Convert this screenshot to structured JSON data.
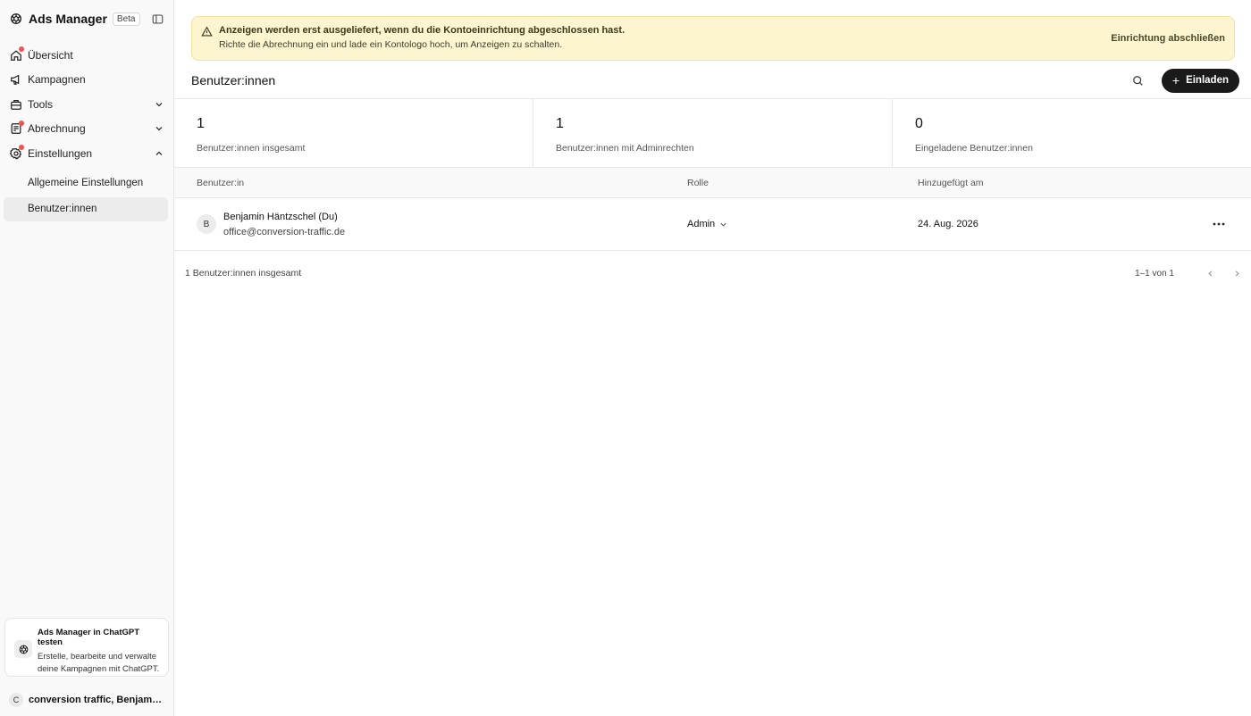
{
  "sidebar": {
    "app_title": "Ads Manager",
    "beta_badge": "Beta",
    "nav": [
      {
        "label": "Übersicht",
        "icon": "home-icon",
        "has_dot": true
      },
      {
        "label": "Kampagnen",
        "icon": "megaphone-icon",
        "has_dot": false
      },
      {
        "label": "Tools",
        "icon": "toolbox-icon",
        "has_dot": false,
        "expandable": true
      },
      {
        "label": "Abrechnung",
        "icon": "billing-icon",
        "has_dot": true,
        "expandable": true
      },
      {
        "label": "Einstellungen",
        "icon": "gear-icon",
        "has_dot": true,
        "expanded": true
      }
    ],
    "sub_items": [
      {
        "label": "Allgemeine Einstellungen",
        "active": false
      },
      {
        "label": "Benutzer:innen",
        "active": true
      }
    ],
    "promo": {
      "title": "Ads Manager in ChatGPT testen",
      "text": "Erstelle, bearbeite und verwalte deine Kampagnen mit ChatGPT."
    },
    "account": {
      "initial": "C",
      "name": "conversion traffic, Benjamin Häntzschel"
    }
  },
  "banner": {
    "title": "Anzeigen werden erst ausgeliefert, wenn du die Kontoeinrichtung abgeschlossen hast.",
    "text": "Richte die Abrechnung ein und lade ein Kontologo hoch, um Anzeigen zu schalten.",
    "action": "Einrichtung abschließen"
  },
  "page": {
    "title": "Benutzer:innen",
    "invite_label": "Einladen"
  },
  "stats": [
    {
      "value": "1",
      "label": "Benutzer:innen insgesamt"
    },
    {
      "value": "1",
      "label": "Benutzer:innen mit Adminrechten"
    },
    {
      "value": "0",
      "label": "Eingeladene Benutzer:innen"
    }
  ],
  "table": {
    "columns": [
      "Benutzer:in",
      "Rolle",
      "Hinzugefügt am"
    ],
    "rows": [
      {
        "initial": "B",
        "name": "Benjamin Häntzschel (Du)",
        "email": "office@conversion-traffic.de",
        "role": "Admin",
        "added": "24. Aug. 2026"
      }
    ]
  },
  "footer": {
    "count": "1 Benutzer:innen insgesamt",
    "pagination": "1–1 von 1"
  },
  "colors": {
    "banner_bg": "#fdf4d0",
    "notification_dot": "#ef5350",
    "primary_button": "#1a1a1a"
  }
}
